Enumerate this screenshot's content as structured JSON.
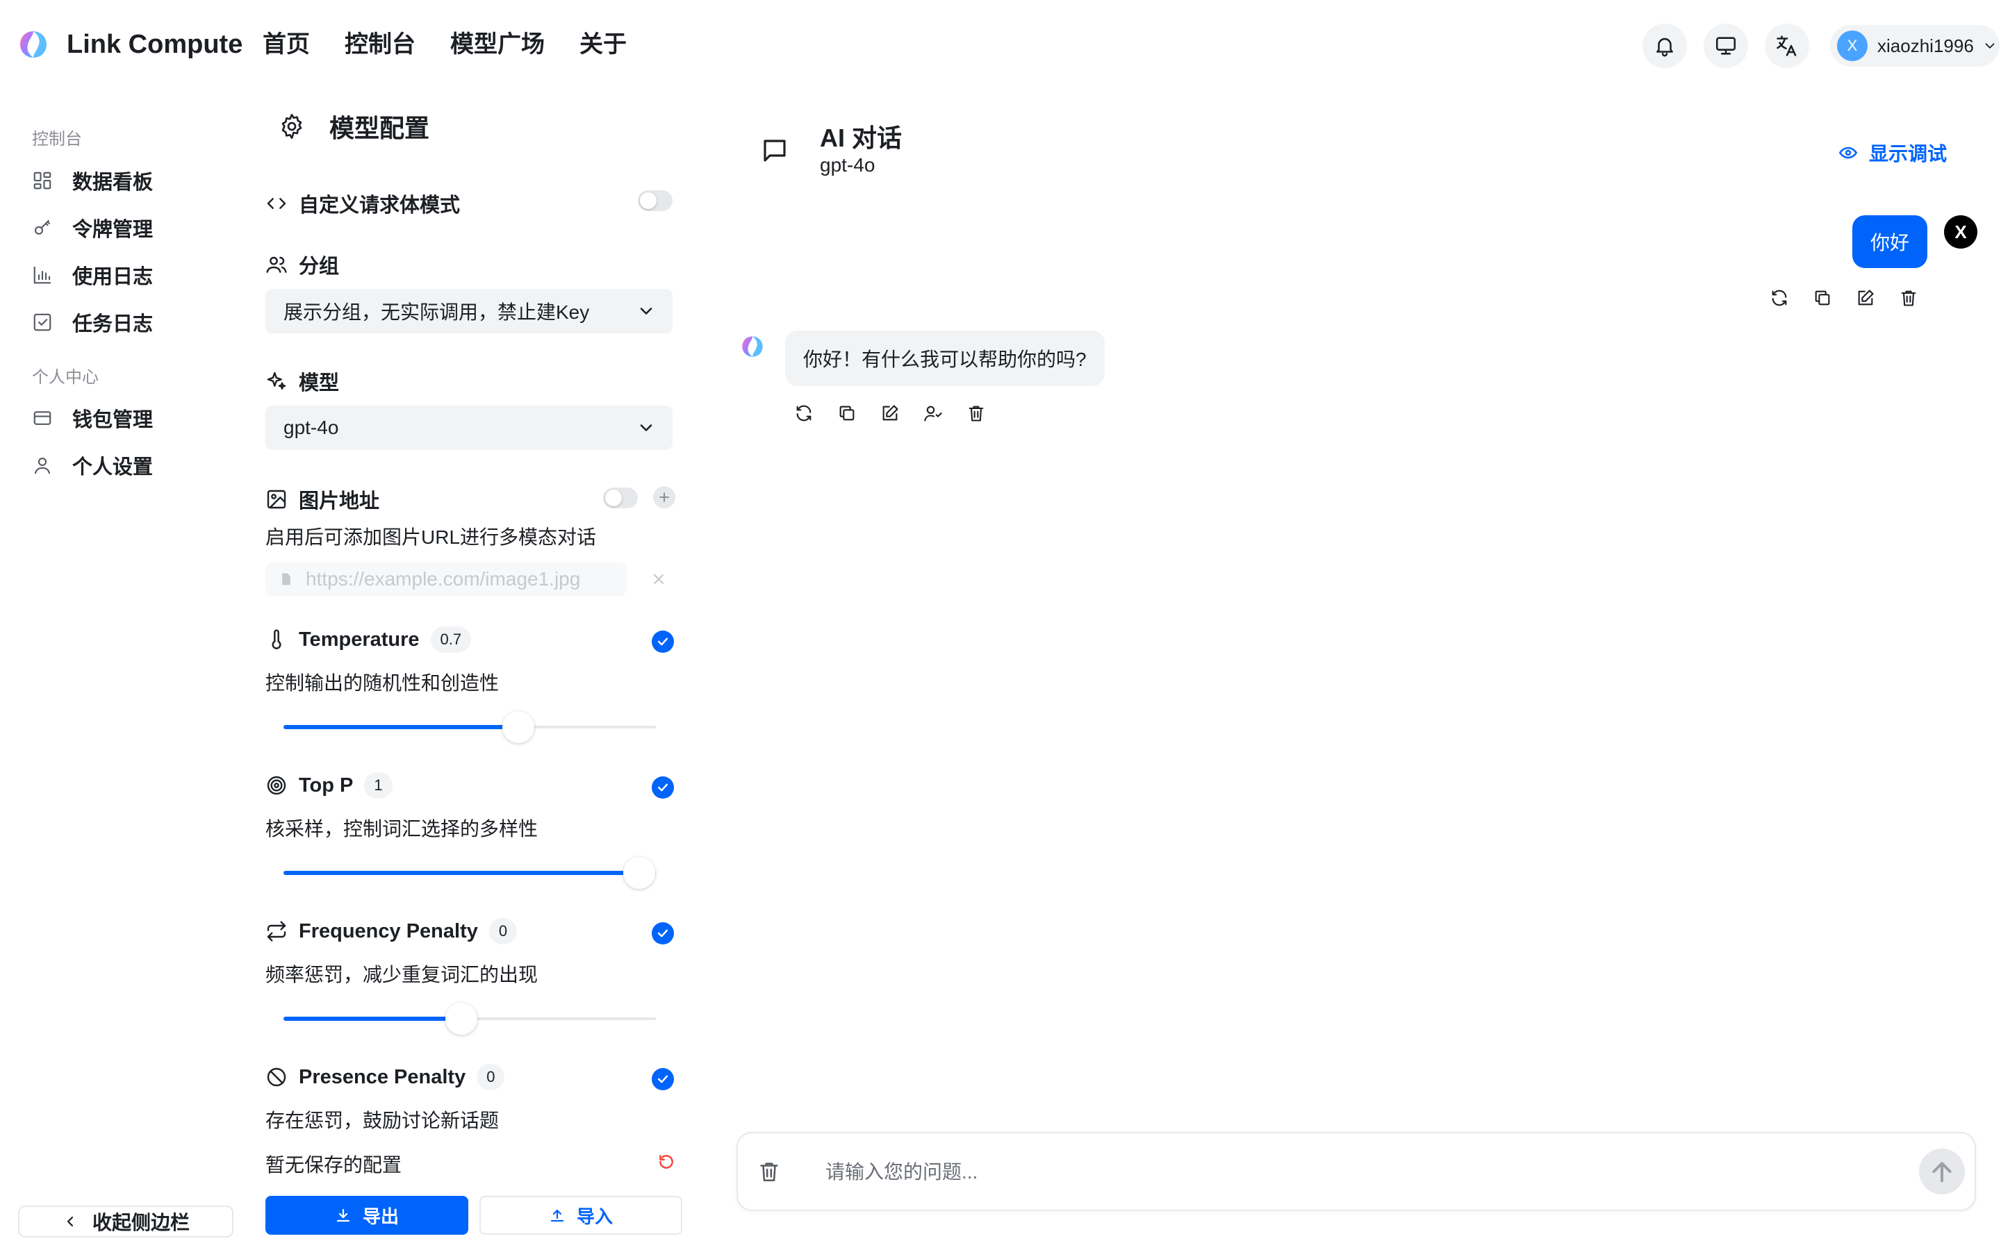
{
  "header": {
    "brand": "Link Compute",
    "nav": [
      "首页",
      "控制台",
      "模型广场",
      "关于"
    ],
    "user": {
      "initial": "X",
      "name": "xiaozhi1996"
    }
  },
  "sidebar": {
    "section1": "控制台",
    "items1": [
      {
        "label": "数据看板",
        "icon": "dashboard-icon"
      },
      {
        "label": "令牌管理",
        "icon": "key-icon"
      },
      {
        "label": "使用日志",
        "icon": "bar-chart-icon"
      },
      {
        "label": "任务日志",
        "icon": "checkbox-icon"
      }
    ],
    "section2": "个人中心",
    "items2": [
      {
        "label": "钱包管理",
        "icon": "wallet-icon"
      },
      {
        "label": "个人设置",
        "icon": "user-icon"
      }
    ],
    "collapse_label": "收起侧边栏"
  },
  "config": {
    "title": "模型配置",
    "custom_body_label": "自定义请求体模式",
    "group_label": "分组",
    "group_value": "展示分组，无实际调用，禁止建Key",
    "model_label": "模型",
    "model_value": "gpt-4o",
    "image_label": "图片地址",
    "image_desc": "启用后可添加图片URL进行多模态对话",
    "image_placeholder": "https://example.com/image1.jpg",
    "params": [
      {
        "label": "Temperature",
        "value": "0.7",
        "desc": "控制输出的随机性和创造性",
        "fraction": 0.66
      },
      {
        "label": "Top P",
        "value": "1",
        "desc": "核采样，控制词汇选择的多样性",
        "fraction": 1.0
      },
      {
        "label": "Frequency Penalty",
        "value": "0",
        "desc": "频率惩罚，减少重复词汇的出现",
        "fraction": 0.5
      },
      {
        "label": "Presence Penalty",
        "value": "0",
        "desc": "存在惩罚，鼓励讨论新话题"
      }
    ],
    "no_saved": "暂无保存的配置",
    "export_label": "导出",
    "import_label": "导入"
  },
  "chat": {
    "title": "AI 对话",
    "model": "gpt-4o",
    "debug_label": "显示调试",
    "user_message": "你好",
    "user_initial": "X",
    "bot_message": "你好！有什么我可以帮助你的吗?",
    "input_placeholder": "请输入您的问题..."
  },
  "colors": {
    "accent": "#0064fa",
    "muted": "#f2f3f5",
    "border": "#e6e8eb"
  }
}
